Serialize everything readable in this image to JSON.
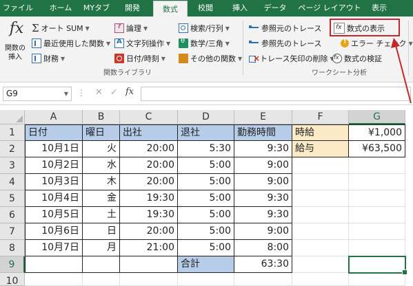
{
  "tabs": [
    {
      "label": "ファイル"
    },
    {
      "label": "ホーム"
    },
    {
      "label": "MYタブ"
    },
    {
      "label": "開発"
    },
    {
      "label": "数式"
    },
    {
      "label": "校閲"
    },
    {
      "label": "挿入"
    },
    {
      "label": "データ"
    },
    {
      "label": "ページ レイアウト"
    },
    {
      "label": "表示"
    }
  ],
  "ribbon": {
    "insert_function": "関数の挿入",
    "autosum": "オート SUM",
    "recent": "最近使用した関数",
    "financial": "財務",
    "logical": "論理",
    "text": "文字列操作",
    "datetime": "日付/時刻",
    "lookup": "検索/行列",
    "math": "数学/三角",
    "more": "その他の関数",
    "library_label": "関数ライブラリ",
    "trace_precedents": "参照元のトレース",
    "trace_dependents": "参照先のトレース",
    "remove_arrows": "トレース矢印の削除",
    "show_formulas": "数式の表示",
    "error_checking": "エラー チェック",
    "evaluate": "数式の検証",
    "audit_label": "ワークシート分析"
  },
  "formula_bar": {
    "name_box": "G9",
    "fx": "fx",
    "content": ""
  },
  "columns": [
    "A",
    "B",
    "C",
    "D",
    "E",
    "F",
    "G"
  ],
  "rows": [
    "1",
    "2",
    "3",
    "4",
    "5",
    "6",
    "7",
    "8",
    "9",
    "10"
  ],
  "selected_cell": "G9",
  "sheet": {
    "headers": {
      "date": "日付",
      "weekday": "曜日",
      "in": "出社",
      "out": "退社",
      "hours": "勤務時間"
    },
    "rate_label": "時給",
    "rate_value": "¥1,000",
    "pay_label": "給与",
    "pay_value": "¥63,500",
    "total_label": "合計",
    "total_value": "63:30",
    "records": [
      {
        "date": "10月1日",
        "weekday": "火",
        "in": "20:00",
        "out": "5:30",
        "hours": "9:30"
      },
      {
        "date": "10月2日",
        "weekday": "水",
        "in": "20:00",
        "out": "5:00",
        "hours": "9:00"
      },
      {
        "date": "10月3日",
        "weekday": "木",
        "in": "20:00",
        "out": "5:00",
        "hours": "9:00"
      },
      {
        "date": "10月4日",
        "weekday": "金",
        "in": "19:30",
        "out": "5:00",
        "hours": "9:30"
      },
      {
        "date": "10月5日",
        "weekday": "土",
        "in": "19:30",
        "out": "5:00",
        "hours": "9:30"
      },
      {
        "date": "10月6日",
        "weekday": "日",
        "in": "20:00",
        "out": "5:00",
        "hours": "9:00"
      },
      {
        "date": "10月7日",
        "weekday": "月",
        "in": "21:00",
        "out": "5:00",
        "hours": "8:00"
      }
    ]
  },
  "colors": {
    "ribbon_green": "#217346",
    "header_blue": "#b7cce8",
    "header_beige": "#fdebc8",
    "callout_red": "#c3272b"
  }
}
